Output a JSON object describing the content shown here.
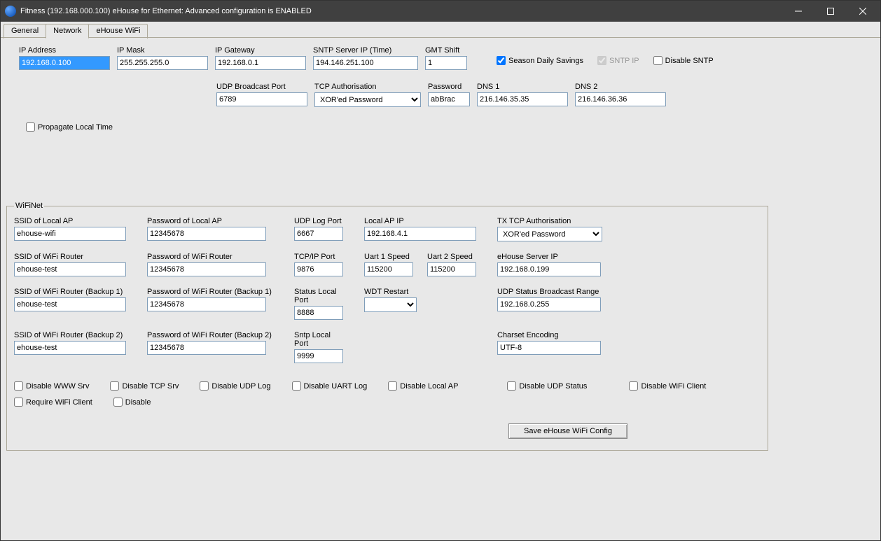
{
  "title": "Fitness (192.168.000.100)    eHouse for Ethernet: Advanced configuration is ENABLED",
  "tabs": {
    "general": "General",
    "network": "Network",
    "ehouse_wifi": "eHouse WiFi"
  },
  "top": {
    "ip_address_label": "IP Address",
    "ip_address": "192.168.0.100",
    "ip_mask_label": "IP Mask",
    "ip_mask": "255.255.255.0",
    "ip_gateway_label": "IP Gateway",
    "ip_gateway": "192.168.0.1",
    "sntp_label": "SNTP Server IP (Time)",
    "sntp": "194.146.251.100",
    "gmt_label": "GMT Shift",
    "gmt": "1",
    "season_label": "Season Daily Savings",
    "sntp_ip_label": "SNTP IP",
    "disable_sntp_label": "Disable SNTP",
    "udp_bcast_label": "UDP Broadcast Port",
    "udp_bcast": "6789",
    "tcp_auth_label": "TCP Authorisation",
    "tcp_auth": "XOR'ed Password",
    "password_label": "Password",
    "password": "abBrac",
    "dns1_label": "DNS 1",
    "dns1": "216.146.35.35",
    "dns2_label": "DNS 2",
    "dns2": "216.146.36.36",
    "propagate_label": "Propagate Local Time"
  },
  "wifinet": {
    "legend": "WiFiNet",
    "ssid_local_label": "SSID of Local AP",
    "ssid_local": "ehouse-wifi",
    "pwd_local_label": "Password of Local AP",
    "pwd_local": "12345678",
    "udp_log_label": "UDP Log Port",
    "udp_log": "6667",
    "local_ap_ip_label": "Local AP IP",
    "local_ap_ip": "192.168.4.1",
    "tx_tcp_auth_label": "TX TCP Authorisation",
    "tx_tcp_auth": "XOR'ed Password",
    "ssid_router_label": "SSID of WiFi Router",
    "ssid_router": "ehouse-test",
    "pwd_router_label": "Password of WiFi Router",
    "pwd_router": "12345678",
    "tcpip_port_label": "TCP/IP Port",
    "tcpip_port": "9876",
    "uart1_label": "Uart 1 Speed",
    "uart1": "115200",
    "uart2_label": "Uart 2 Speed",
    "uart2": "115200",
    "server_ip_label": "eHouse Server IP",
    "server_ip": "192.168.0.199",
    "ssid_b1_label": "SSID of WiFi Router (Backup 1)",
    "ssid_b1": "ehouse-test",
    "pwd_b1_label": "Password of WiFi Router  (Backup 1)",
    "pwd_b1": "12345678",
    "status_port_label": "Status Local Port",
    "status_port": "8888",
    "wdt_label": "WDT Restart",
    "udp_status_range_label": "UDP Status Broadcast Range",
    "udp_status_range": "192.168.0.255",
    "ssid_b2_label": "SSID of WiFi Router  (Backup 2)",
    "ssid_b2": "ehouse-test",
    "pwd_b2_label": "Password of WiFi Router  (Backup 2)",
    "pwd_b2": "12345678",
    "sntp_port_label": "Sntp Local Port",
    "sntp_port": "9999",
    "charset_label": "Charset Encoding",
    "charset": "UTF-8",
    "chk": {
      "disable_www": "Disable WWW Srv",
      "disable_tcp": "Disable TCP Srv",
      "disable_udp_log": "Disable UDP Log",
      "disable_uart_log": "Disable UART Log",
      "disable_local_ap": "Disable Local AP",
      "disable_udp_status": "Disable UDP Status",
      "disable_wifi_client": "Disable WiFi Client",
      "require_wifi_client": "Require WiFi Client",
      "disable": "Disable"
    },
    "save_btn": "Save eHouse WiFi Config"
  }
}
